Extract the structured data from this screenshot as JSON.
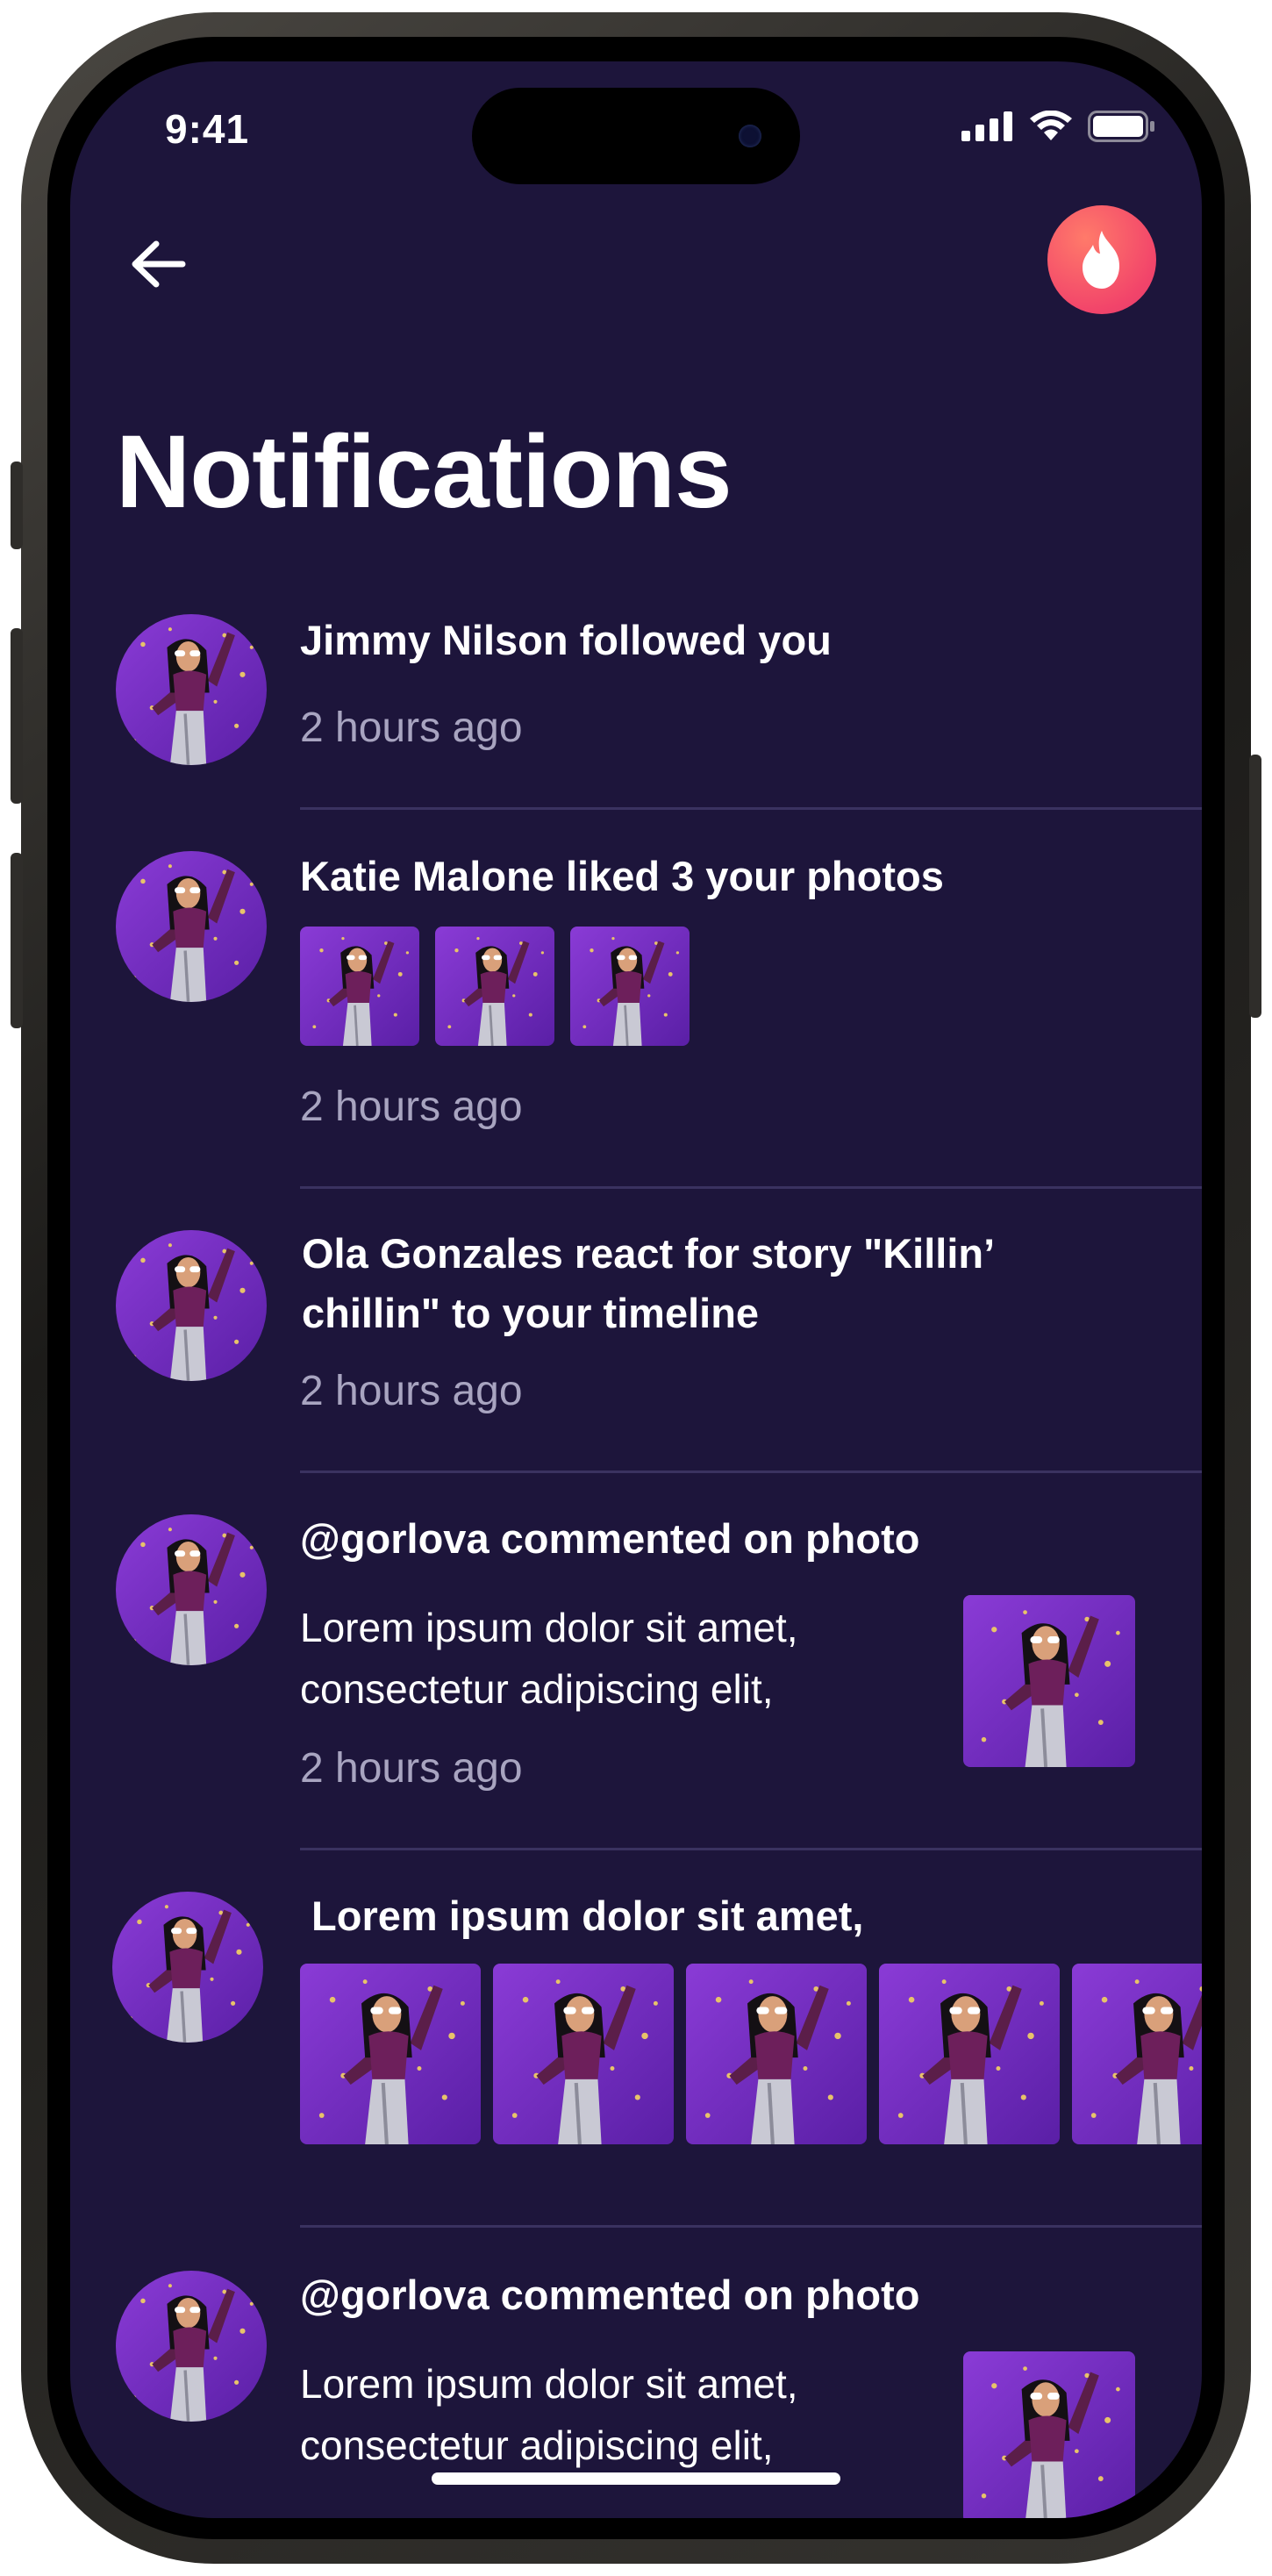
{
  "status_bar": {
    "time": "9:41",
    "icons": [
      "signal-icon",
      "wifi-icon",
      "battery-icon"
    ]
  },
  "header": {
    "back_icon": "arrow-left-icon",
    "action_icon": "flame-icon",
    "title": "Notifications"
  },
  "notifications": [
    {
      "title": "Jimmy Nilson followed you",
      "time": "2 hours ago"
    },
    {
      "title": "Katie Malone liked 3 your photos",
      "photo_count": 3,
      "time": "2 hours ago"
    },
    {
      "title_line1": "Ola Gonzales react for story \"Killin’",
      "title_line2": "chillin\" to your timeline",
      "time": "2 hours ago"
    },
    {
      "title": "@gorlova commented on photo",
      "body": " Lorem ipsum dolor sit amet,\nconsectetur adipiscing elit,",
      "time": "2 hours ago"
    },
    {
      "title": " Lorem ipsum dolor sit amet,",
      "photo_count": 5
    },
    {
      "title": "@gorlova commented on photo",
      "body": " Lorem ipsum dolor sit amet,\nconsectetur adipiscing elit,"
    }
  ],
  "colors": {
    "background": "#1d153b",
    "accent": "#f2456a",
    "muted_text": "#a8a4c0",
    "photo_bg": "#7a2fc8"
  }
}
